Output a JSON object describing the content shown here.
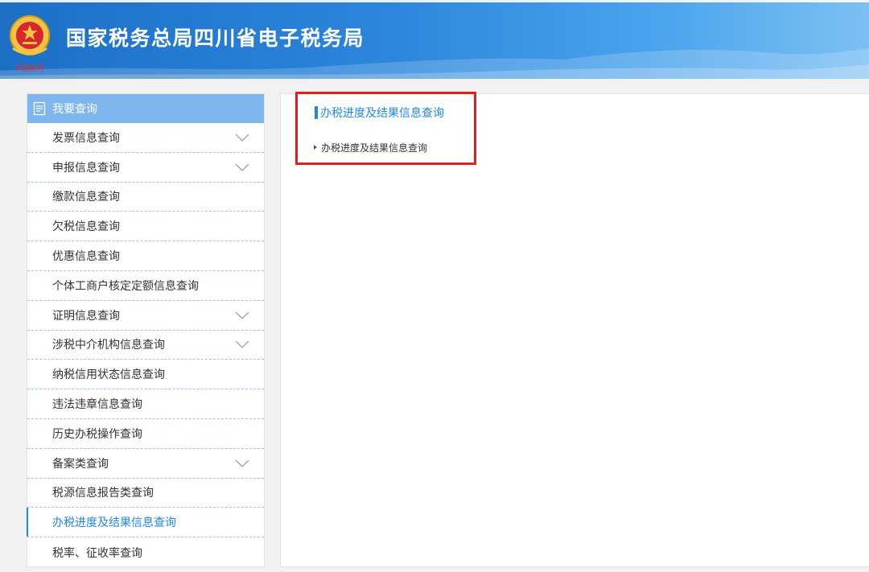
{
  "header": {
    "title": "国家税务总局四川省电子税务局",
    "emblem_icon": "tax-emblem-icon",
    "emblem_caption": "中国税务",
    "colors": {
      "primary": "#2c86dc",
      "light": "#7cc0f3"
    }
  },
  "sidebar": {
    "heading": "我要查询",
    "heading_icon": "document-list-icon",
    "items": [
      {
        "label": "发票信息查询",
        "expandable": true
      },
      {
        "label": "申报信息查询",
        "expandable": true
      },
      {
        "label": "缴款信息查询",
        "expandable": false
      },
      {
        "label": "欠税信息查询",
        "expandable": false
      },
      {
        "label": "优惠信息查询",
        "expandable": false
      },
      {
        "label": "个体工商户核定定额信息查询",
        "expandable": false
      },
      {
        "label": "证明信息查询",
        "expandable": true
      },
      {
        "label": "涉税中介机构信息查询",
        "expandable": true
      },
      {
        "label": "纳税信用状态信息查询",
        "expandable": false
      },
      {
        "label": "违法违章信息查询",
        "expandable": false
      },
      {
        "label": "历史办税操作查询",
        "expandable": false
      },
      {
        "label": "备案类查询",
        "expandable": true
      },
      {
        "label": "税源信息报告类查询",
        "expandable": false
      },
      {
        "label": "办税进度及结果信息查询",
        "expandable": false,
        "active": true
      },
      {
        "label": "税率、征收率查询",
        "expandable": false
      }
    ]
  },
  "content": {
    "section_title": "办税进度及结果信息查询",
    "sub_link": "办税进度及结果信息查询",
    "highlight_color": "#e31b1b",
    "accent_color": "#1e88e5"
  }
}
